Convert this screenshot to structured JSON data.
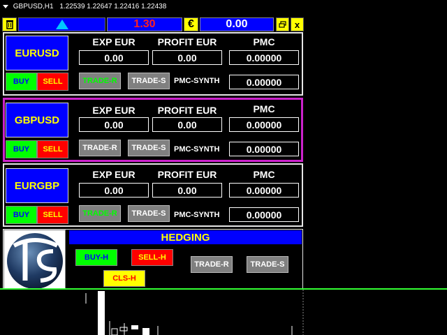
{
  "chart_header": {
    "symbol_tf": "GBPUSD,H1",
    "ohlc": "1.22539 1.22647 1.22416 1.22438"
  },
  "topbar": {
    "spread": "1.30",
    "currency_symbol": "€",
    "total_profit": "0.00",
    "close_label": "x"
  },
  "column_labels": {
    "exp": "EXP EUR",
    "profit": "PROFIT EUR",
    "pmc": "PMC",
    "pmc_synth": "PMC-SYNTH"
  },
  "buttons": {
    "buy": "BUY",
    "sell": "SELL",
    "trade_r": "TRADE-R",
    "trade_s": "TRADE-S"
  },
  "pairs": [
    {
      "symbol": "EURUSD",
      "exp": "0.00",
      "profit": "0.00",
      "pmc": "0.00000",
      "pmc_synth": "0.00000"
    },
    {
      "symbol": "GBPUSD",
      "exp": "0.00",
      "profit": "0.00",
      "pmc": "0.00000",
      "pmc_synth": "0.00000"
    },
    {
      "symbol": "EURGBP",
      "exp": "0.00",
      "profit": "0.00",
      "pmc": "0.00000",
      "pmc_synth": "0.00000"
    }
  ],
  "hedging": {
    "title": "HEDGING",
    "buy_h": "BUY-H",
    "sell_h": "SELL-H",
    "cls_h": "CLS-H",
    "trade_r": "TRADE-R",
    "trade_s": "TRADE-S"
  },
  "colors": {
    "panel_blue": "#0000ff",
    "accent_yellow": "#ffff00",
    "buy_green": "#00ff00",
    "sell_red": "#ff0000",
    "selected_border": "#cc22cc",
    "trade_gray": "#808080"
  }
}
